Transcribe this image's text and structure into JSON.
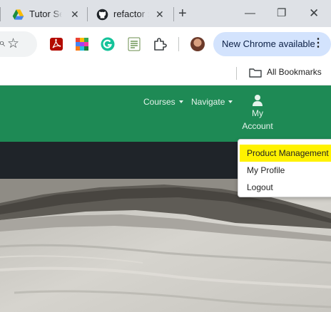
{
  "browser": {
    "tabs": [
      {
        "title": "Tutor Ser",
        "favicon": "google-drive-icon"
      },
      {
        "title": "refactor :",
        "favicon": "github-icon"
      }
    ],
    "new_tab_symbol": "+",
    "window_controls": {
      "minimize": "—",
      "maximize": "❐",
      "close": "✕"
    },
    "toolbar": {
      "extensions": [
        "adobe-pdf-icon",
        "color-grid-icon",
        "grammarly-icon",
        "sheet-extension-icon",
        "puzzle-icon"
      ],
      "update_label": "New Chrome available",
      "menu_dots": "⋮"
    },
    "bookmarks": {
      "all_bookmarks_label": "All Bookmarks"
    }
  },
  "site": {
    "nav": {
      "courses_label": "Courses",
      "navigate_label": "Navigate",
      "account_line1": "My",
      "account_line2": "Account"
    },
    "account_menu": [
      {
        "label": "Product Management",
        "highlighted": true
      },
      {
        "label": "My Profile",
        "highlighted": false
      },
      {
        "label": "Logout",
        "highlighted": false
      }
    ]
  },
  "colors": {
    "site_green": "#1e8a55",
    "dark_bar": "#1f2429",
    "highlight_yellow": "#fff200",
    "update_pill": "#d3e3fd"
  }
}
